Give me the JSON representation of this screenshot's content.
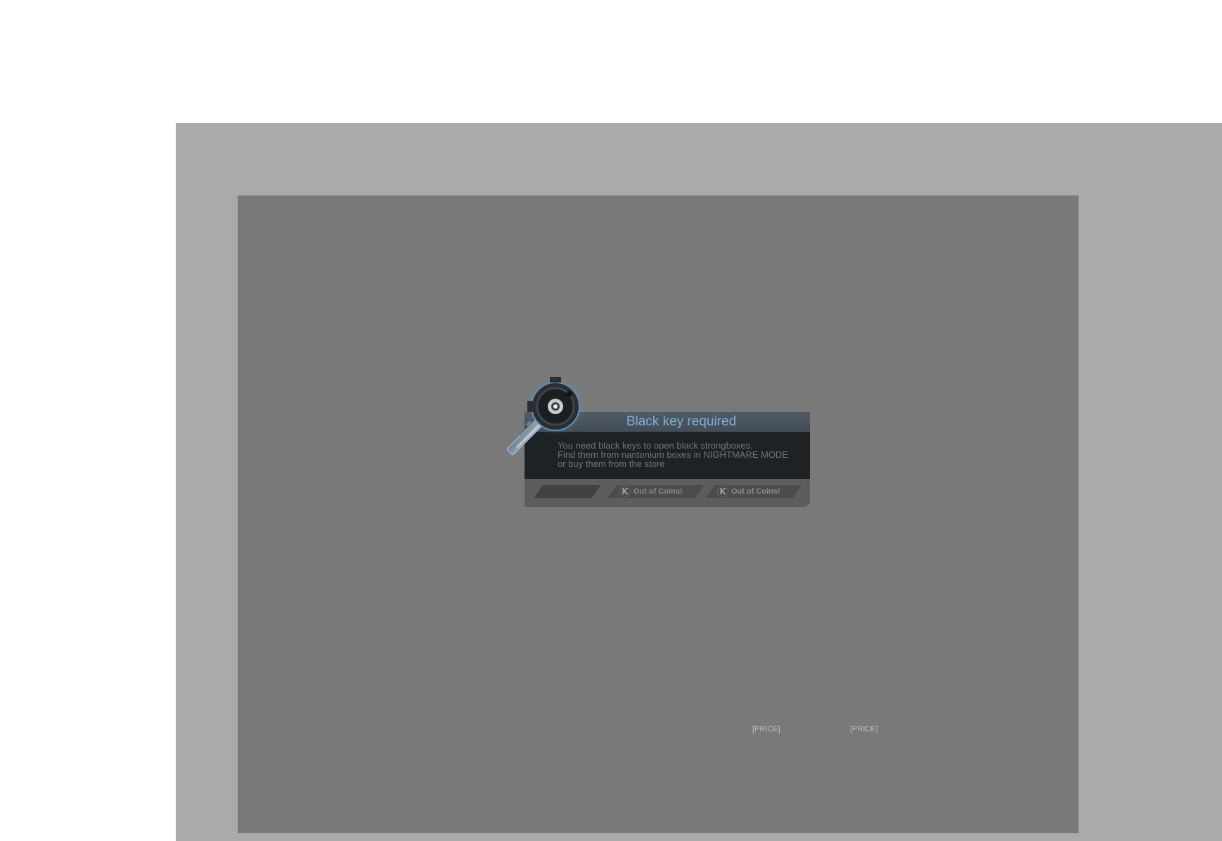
{
  "dialog": {
    "title": "Black key required",
    "message_lines": [
      "You need black keys to open black strongboxes.",
      "Find them from nantonium boxes in NIGHTMARE MODE",
      "or buy them from the store"
    ],
    "buttons": [
      {
        "label": "",
        "icon": null
      },
      {
        "label": "Out of Coins!",
        "icon": "k-coin-icon",
        "icon_letter": "K"
      },
      {
        "label": "Out of Coins!",
        "icon": "k-coin-icon",
        "icon_letter": "K"
      }
    ]
  },
  "background": {
    "price_labels": [
      "[PRICE]",
      "[PRICE]"
    ]
  },
  "colors": {
    "title": "#7eb0d8",
    "dialog_body": "#1f2225",
    "overlay": "#797979",
    "outer_frame": "#aaaaaa"
  }
}
